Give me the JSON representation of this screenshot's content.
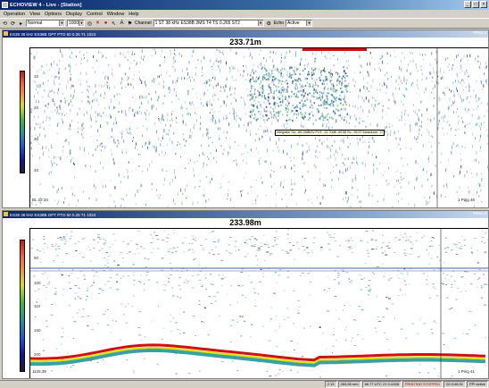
{
  "window": {
    "title": "ECHOVIEW 4 - Live - [Station]"
  },
  "menu": [
    "Operation",
    "View",
    "Options",
    "Display",
    "Control",
    "Window",
    "Help"
  ],
  "toolbar": {
    "mode_value": "Normal",
    "range_value": "1000",
    "channel_label": "Channel",
    "channel_value": "1 ST 38 kHz ES38B 2MS T4 TS 0.265 ST2",
    "echo_label": "Echo",
    "echo_value": "Active"
  },
  "panels": [
    {
      "title": "ES38 38 kHz ES38B GPT PTO 60 0.25 T1 1024",
      "right": "PRes 1",
      "distance": "233.71m",
      "depth_labels": [
        "10",
        "20",
        "30",
        "40"
      ],
      "corner_left": "BL 22:34",
      "corner_right": "1 Ping 46",
      "tooltip": "Integrator Sa: -65.19dB/Sv PLS: -22.70dB -69.58 Sv: -39.57 transducer: 27"
    },
    {
      "title": "ES38 38 kHz ES38B GPT PTO 60 0.25 T1 1024",
      "right": "PRes 2",
      "distance": "233.98m",
      "depth_labels": [
        "50",
        "100",
        "110",
        "150",
        "200"
      ],
      "corner_left": "1125.38",
      "corner_right": "1 Ping 41"
    }
  ],
  "status": {
    "cells": [
      "2.13",
      "283.65 mm",
      "66.77 UTC 21 0.4158",
      "PRINTING STOPPED",
      "02:3:48.91",
      "PPI active"
    ]
  },
  "colors": {
    "bottom_line": "#d01010",
    "accent": "#0a246a"
  }
}
